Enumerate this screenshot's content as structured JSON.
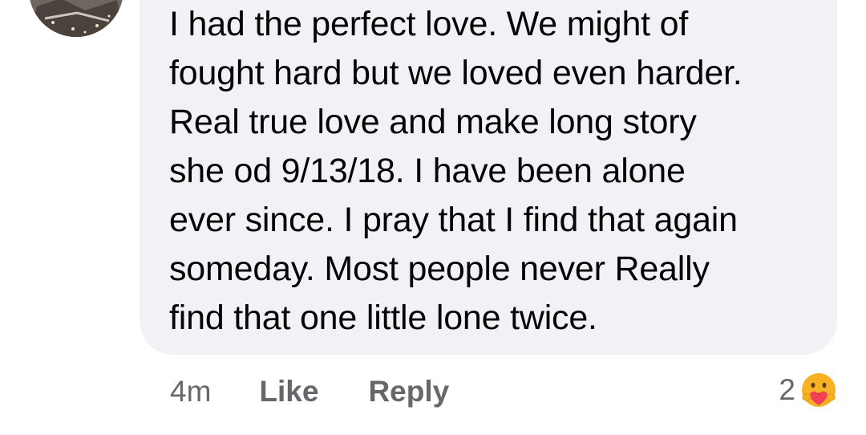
{
  "comment": {
    "text": "I had the perfect love. We might of\nfought hard but we loved even harder.\nReal true love and make long story\nshe od 9/13/18. I have been alone\never since. I pray that I find that again\nsomeday. Most people never Really\nfind that one little lone twice."
  },
  "actions": {
    "time": "4m",
    "like_label": "Like",
    "reply_label": "Reply"
  },
  "reactions": {
    "count": "2",
    "icon": "care-reaction-icon",
    "icon_colors": {
      "face": "#f7b125",
      "heart": "#f33e58"
    }
  },
  "colors": {
    "bubble_bg": "#f0f2f5",
    "text": "#050505",
    "secondary_text": "#65676b"
  }
}
